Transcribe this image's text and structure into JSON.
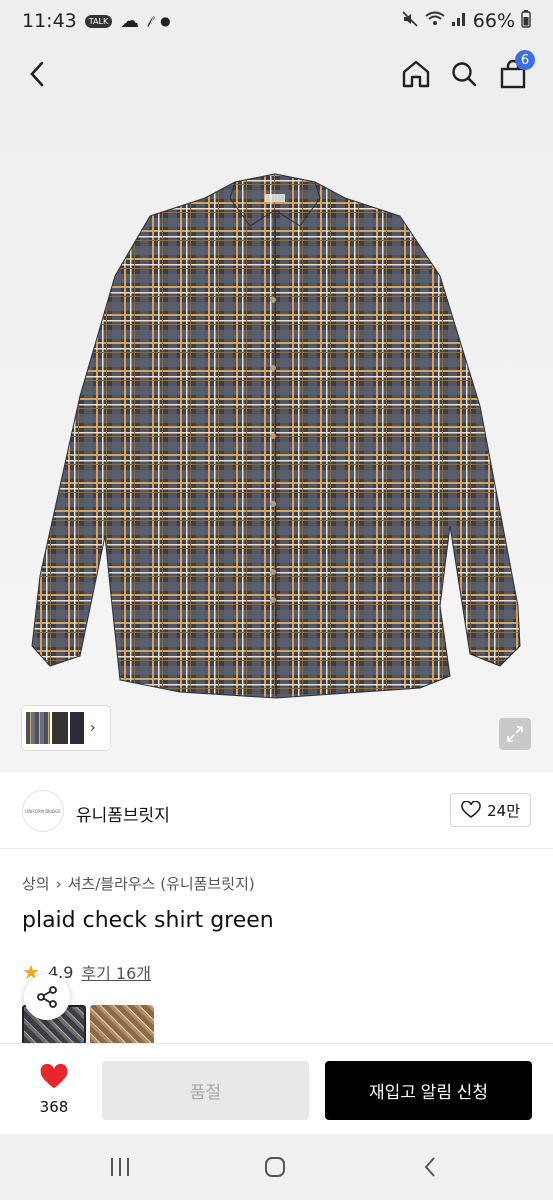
{
  "status_bar": {
    "time": "11:43",
    "talk_badge": "TALK",
    "battery": "66%"
  },
  "header": {
    "back_icon": "chevron-left-icon",
    "home_icon": "home-icon",
    "search_icon": "search-icon",
    "cart_icon": "cart-icon",
    "cart_count": "6"
  },
  "brand": {
    "logo_text": "UNIFORM BRIDGE",
    "name": "유니폼브릿지",
    "like_count": "24만"
  },
  "breadcrumb": {
    "items": [
      "상의",
      "셔츠/블라우스 (유니폼브릿지)"
    ]
  },
  "product": {
    "title": "plaid check shirt green",
    "rating": "4.9",
    "reviews": "후기 16개"
  },
  "bottom": {
    "wish_count": "368",
    "soldout_label": "품절",
    "restock_label": "재입고 알림 신청"
  },
  "colors": {
    "accent_blue": "#3b6fe0",
    "heart_red": "#e8262c",
    "star_orange": "#f5a623"
  }
}
